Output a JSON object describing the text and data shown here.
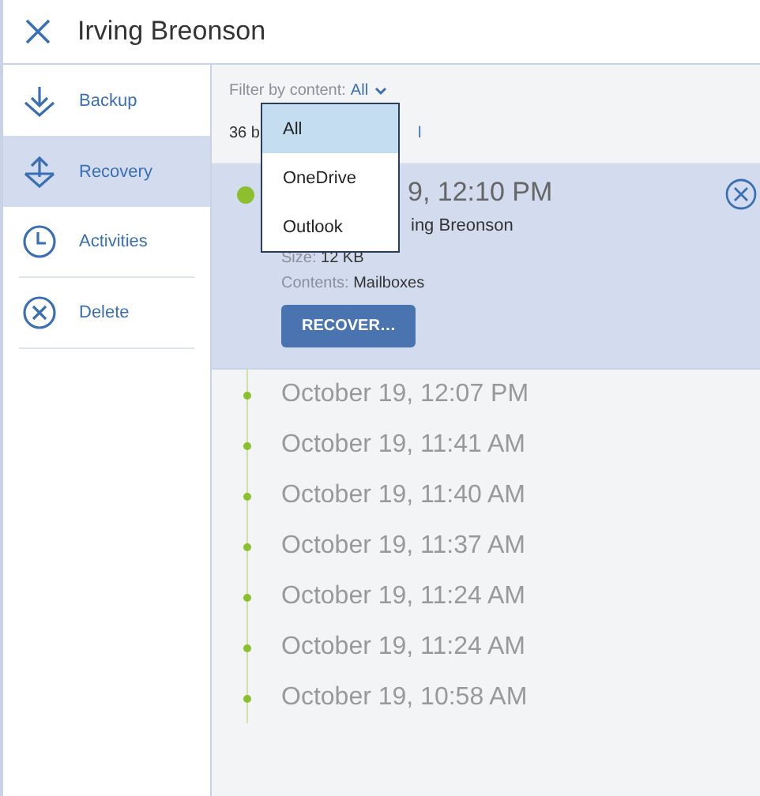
{
  "header": {
    "title": "Irving Breonson"
  },
  "sidebar": {
    "items": [
      {
        "label": "Backup",
        "selected": false
      },
      {
        "label": "Recovery",
        "selected": true
      },
      {
        "label": "Activities",
        "selected": false
      },
      {
        "label": "Delete",
        "selected": false
      }
    ]
  },
  "filter": {
    "label": "Filter by content:",
    "value": "All"
  },
  "dropdown": {
    "options": [
      {
        "label": "All",
        "selected": true
      },
      {
        "label": "OneDrive",
        "selected": false
      },
      {
        "label": "Outlook",
        "selected": false
      }
    ]
  },
  "count_text": "36 b",
  "link_fragment": "l",
  "selected_backup": {
    "time": "9, 12:10 PM",
    "line_2": "ing Breonson",
    "size_label": "Size:",
    "size": "12 KB",
    "contents_label": "Contents:",
    "contents": "Mailboxes",
    "button": "RECOVER…"
  },
  "backups": [
    "October 19, 12:07 PM",
    "October 19, 11:41 AM",
    "October 19, 11:40 AM",
    "October 19, 11:37 AM",
    "October 19, 11:24 AM",
    "October 19, 11:24 AM",
    "October 19, 10:58 AM"
  ]
}
